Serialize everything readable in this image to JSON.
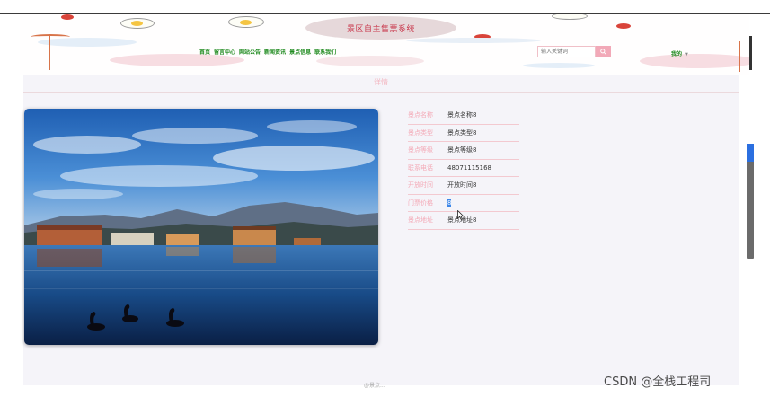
{
  "header": {
    "title": "景区自主售票系统",
    "nav": [
      "首页",
      "留言中心",
      "网站公告",
      "新闻资讯",
      "景点信息",
      "联系我们"
    ],
    "search_placeholder": "输入关键词",
    "user_menu": "我的"
  },
  "page": {
    "section_title": "详情"
  },
  "details": [
    {
      "label": "景点名称",
      "value": "景点名称8"
    },
    {
      "label": "景点类型",
      "value": "景点类型8"
    },
    {
      "label": "景点等级",
      "value": "景点等级8"
    },
    {
      "label": "联系电话",
      "value": "48071115168"
    },
    {
      "label": "开放时间",
      "value": "开放时间8"
    },
    {
      "label": "门票价格",
      "value": "8"
    },
    {
      "label": "景点地址",
      "value": "景点地址8"
    }
  ],
  "footer": {
    "text": "@景点..."
  },
  "watermark": "CSDN @全栈工程司",
  "colors": {
    "accent_pink": "#f4aab7",
    "nav_green": "#1e8a1e",
    "title_red": "#c93a4e",
    "selection_blue": "#3d86e8"
  }
}
